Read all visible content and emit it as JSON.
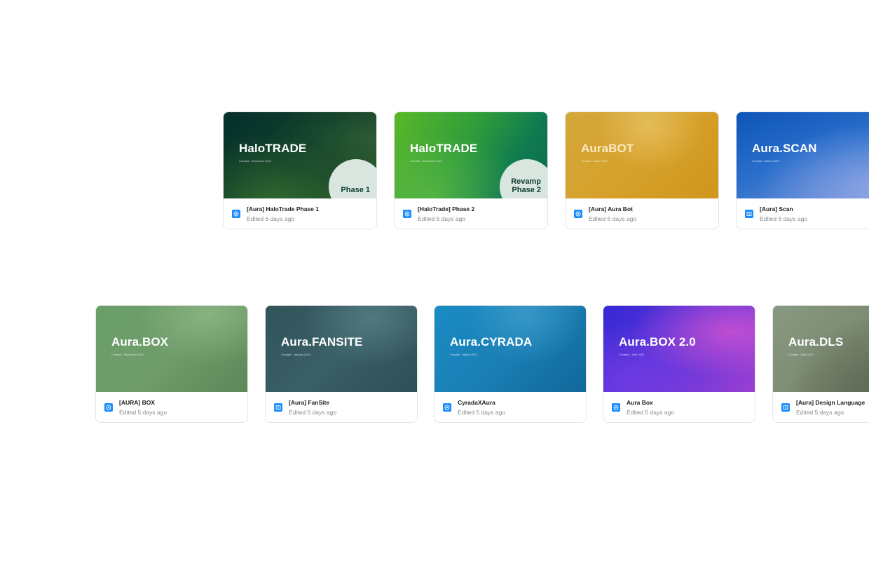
{
  "row1": [
    {
      "thumb_title": "HaloTRADE",
      "thumb_subtitle": "Created : December 2022",
      "badge": "Phase 1",
      "name": "[Aura] HaloTrade Phase 1",
      "edited": "Edited 6 days ago",
      "icon": "compass-icon"
    },
    {
      "thumb_title": "HaloTRADE",
      "thumb_subtitle": "Created : December 2022",
      "badge": "Revamp\nPhase 2",
      "name": "[HaloTrade] Phase 2",
      "edited": "Edited 6 days ago",
      "icon": "compass-icon"
    },
    {
      "thumb_title": "AuraBOT",
      "thumb_subtitle": "Created : March 2023",
      "name": "[Aura] Aura Bot",
      "edited": "Edited 6 days ago",
      "icon": "compass-icon"
    },
    {
      "thumb_title": "Aura.SCAN",
      "thumb_subtitle": "Created : March 2023",
      "name": "[Aura] Scan",
      "edited": "Edited 6 days ago",
      "icon": "book-icon"
    }
  ],
  "row2": [
    {
      "thumb_title": "Aura.BOX",
      "thumb_subtitle": "Created : November 2022",
      "name": "[AURA] BOX",
      "edited": "Edited 5 days ago",
      "icon": "compass-icon"
    },
    {
      "thumb_title": "Aura.FANSITE",
      "thumb_subtitle": "Created : January 2023",
      "name": "[Aura] FanSite",
      "edited": "Edited 5 days ago",
      "icon": "book-icon"
    },
    {
      "thumb_title": "Aura.CYRADA",
      "thumb_subtitle": "Created : March 2023",
      "name": "CyradaXAura",
      "edited": "Edited 5 days ago",
      "icon": "compass-icon"
    },
    {
      "thumb_title": "Aura.BOX 2.0",
      "thumb_subtitle": "Created : June 2023",
      "name": "Aura Box",
      "edited": "Edited 5 days ago",
      "icon": "compass-icon"
    },
    {
      "thumb_title": "Aura.DLS",
      "thumb_subtitle": "Created : April 2023",
      "name": "[Aura] Design Language",
      "edited": "Edited 5 days ago",
      "icon": "book-icon"
    }
  ]
}
